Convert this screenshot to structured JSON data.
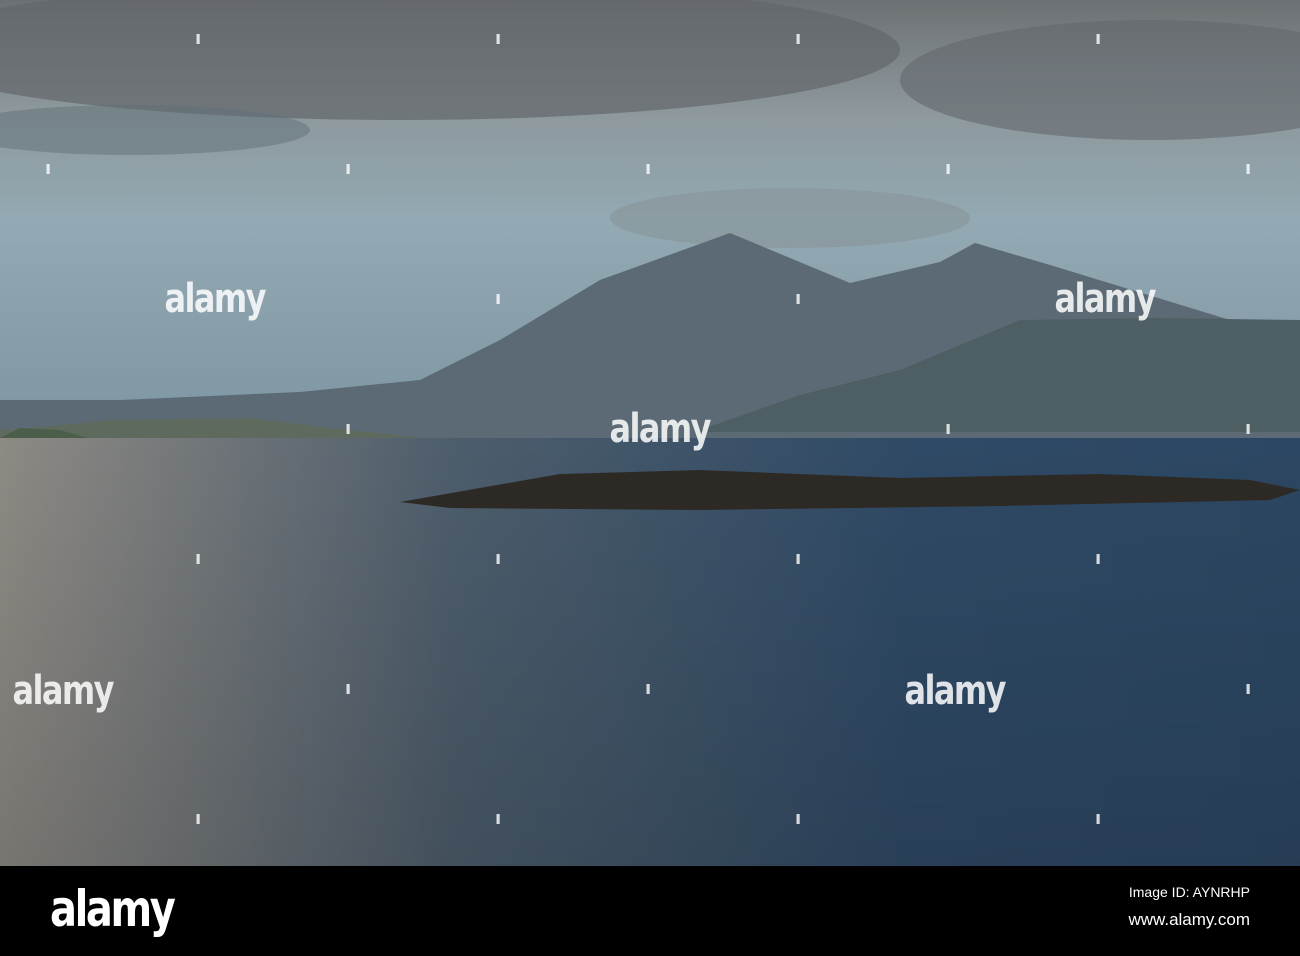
{
  "photo": {
    "subject": "Mountains over a sea loch with a low rocky island"
  },
  "watermark": {
    "text": "alamy"
  },
  "footer": {
    "logo": "alamy",
    "image_id": "Image ID: AYNRHP",
    "url": "www.alamy.com"
  }
}
